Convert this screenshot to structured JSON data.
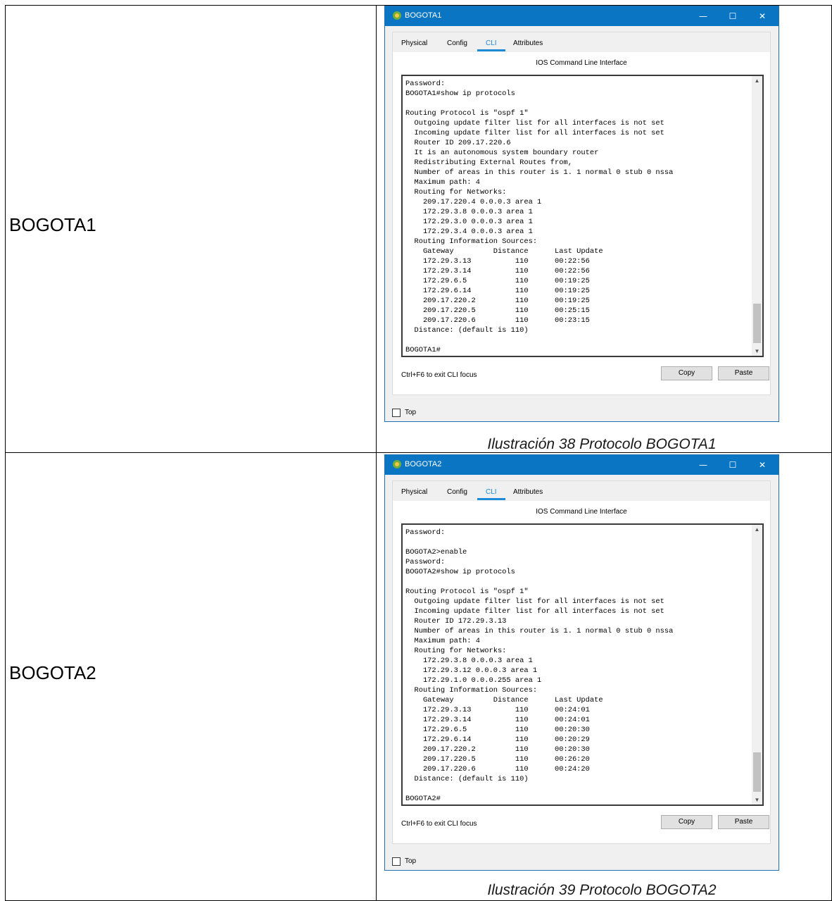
{
  "rows": [
    {
      "label": "BOGOTA1",
      "caption": "Ilustración 38 Protocolo BOGOTA1",
      "window": {
        "title": "BOGOTA1",
        "tabs": [
          "Physical",
          "Config",
          "CLI",
          "Attributes"
        ],
        "active_tab": "CLI",
        "cli_header": "IOS Command Line Interface",
        "terminal_text": "Password:\nBOGOTA1#show ip protocols\n\nRouting Protocol is \"ospf 1\"\n  Outgoing update filter list for all interfaces is not set\n  Incoming update filter list for all interfaces is not set\n  Router ID 209.17.220.6\n  It is an autonomous system boundary router\n  Redistributing External Routes from,\n  Number of areas in this router is 1. 1 normal 0 stub 0 nssa\n  Maximum path: 4\n  Routing for Networks:\n    209.17.220.4 0.0.0.3 area 1\n    172.29.3.8 0.0.0.3 area 1\n    172.29.3.0 0.0.0.3 area 1\n    172.29.3.4 0.0.0.3 area 1\n  Routing Information Sources:\n    Gateway         Distance      Last Update\n    172.29.3.13          110      00:22:56\n    172.29.3.14          110      00:22:56\n    172.29.6.5           110      00:19:25\n    172.29.6.14          110      00:19:25\n    209.17.220.2         110      00:19:25\n    209.17.220.5         110      00:25:15\n    209.17.220.6         110      00:23:15\n  Distance: (default is 110)\n\nBOGOTA1#",
        "hint": "Ctrl+F6 to exit CLI focus",
        "copy_label": "Copy",
        "paste_label": "Paste",
        "top_label": "Top",
        "top_checked": false
      }
    },
    {
      "label": "BOGOTA2",
      "caption": "Ilustración 39 Protocolo BOGOTA2",
      "window": {
        "title": "BOGOTA2",
        "tabs": [
          "Physical",
          "Config",
          "CLI",
          "Attributes"
        ],
        "active_tab": "CLI",
        "cli_header": "IOS Command Line Interface",
        "terminal_text": "Password:\n\nBOGOTA2>enable\nPassword:\nBOGOTA2#show ip protocols\n\nRouting Protocol is \"ospf 1\"\n  Outgoing update filter list for all interfaces is not set\n  Incoming update filter list for all interfaces is not set\n  Router ID 172.29.3.13\n  Number of areas in this router is 1. 1 normal 0 stub 0 nssa\n  Maximum path: 4\n  Routing for Networks:\n    172.29.3.8 0.0.0.3 area 1\n    172.29.3.12 0.0.0.3 area 1\n    172.29.1.0 0.0.0.255 area 1\n  Routing Information Sources:\n    Gateway         Distance      Last Update\n    172.29.3.13          110      00:24:01\n    172.29.3.14          110      00:24:01\n    172.29.6.5           110      00:20:30\n    172.29.6.14          110      00:20:29\n    209.17.220.2         110      00:20:30\n    209.17.220.5         110      00:26:20\n    209.17.220.6         110      00:24:20\n  Distance: (default is 110)\n\nBOGOTA2#",
        "hint": "Ctrl+F6 to exit CLI focus",
        "copy_label": "Copy",
        "paste_label": "Paste",
        "top_label": "Top",
        "top_checked": false
      }
    }
  ],
  "icons": {
    "app": "packet-tracer-router-icon",
    "minimize": "minimize-icon",
    "maximize": "maximize-icon",
    "close": "close-icon",
    "scroll_up": "scroll-up-icon",
    "scroll_down": "scroll-down-icon"
  },
  "colors": {
    "titlebar": "#0a75c2",
    "active_tab": "#1a8bd4",
    "window_bg": "#f0f0f0"
  }
}
